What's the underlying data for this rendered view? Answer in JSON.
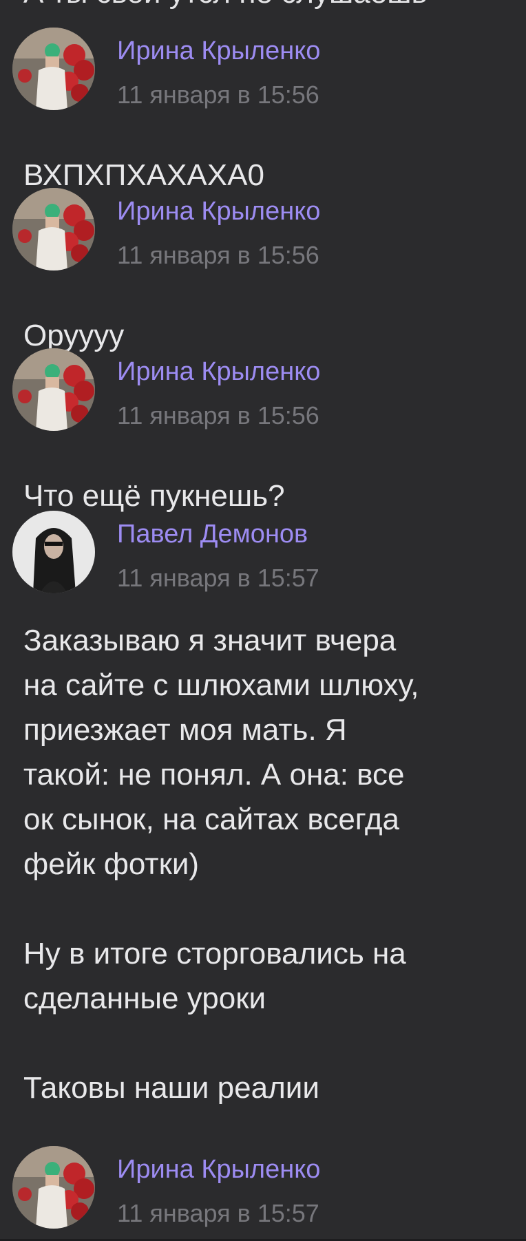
{
  "clipped_previous_text": "А ты свой утсл не слушаешь",
  "messages": [
    {
      "author": "Ирина Крыленко",
      "time": "11 января в 15:56",
      "text": "ВХПХПХАХАХА0",
      "avatar": "woman-red-balloons"
    },
    {
      "author": "Ирина Крыленко",
      "time": "11 января в 15:56",
      "text": "Оруууу",
      "avatar": "woman-red-balloons"
    },
    {
      "author": "Ирина Крыленко",
      "time": "11 января в 15:56",
      "text": "Что ещё пукнешь?",
      "avatar": "woman-red-balloons"
    },
    {
      "author": "Павел Демонов",
      "time": "11 января в 15:57",
      "text": "Заказываю я значит вчера\nна сайте с шлюхами шлюху,\nприезжает моя мать. Я\nтакой: не понял. А она: все\nок сынок, на сайтах всегда\nфейк фотки)\n\nНу в итоге сторговались на\nсделанные уроки\n\nТаковы наши реалии",
      "avatar": "long-haired-man-sunglasses"
    },
    {
      "author": "Ирина Крыленко",
      "time": "11 января в 15:57",
      "text": "",
      "avatar": "woman-red-balloons"
    }
  ],
  "colors": {
    "background": "#2b2b2d",
    "author": "#9d8cf2",
    "time": "#77777c",
    "text": "#e8e8ea"
  }
}
